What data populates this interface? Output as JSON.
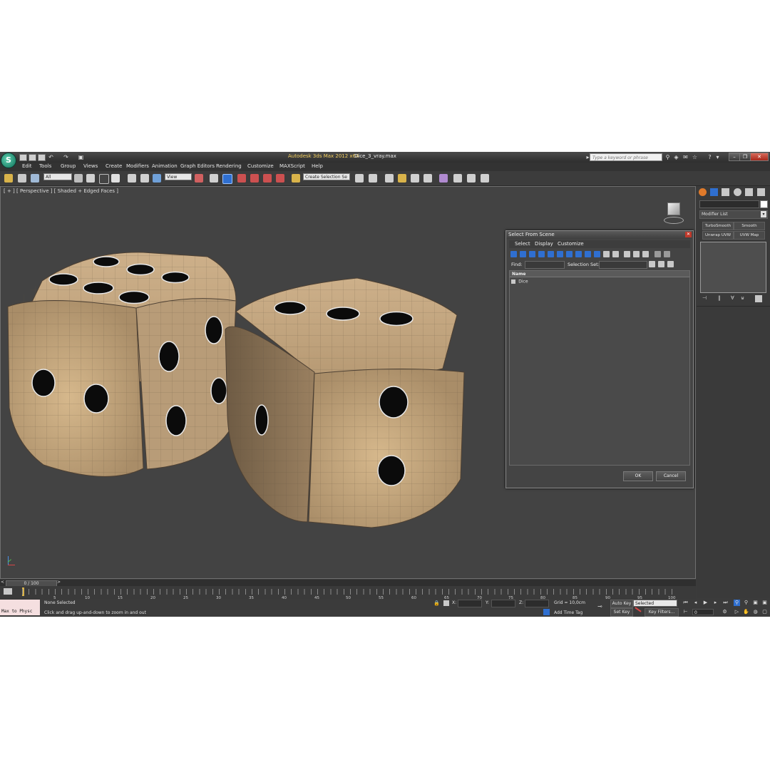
{
  "titlebar": {
    "app_title": "Autodesk 3ds Max  2012 x64",
    "file_name": "Dice_3_vray.max",
    "search_placeholder": "Type a keyword or phrase"
  },
  "menubar": [
    "Edit",
    "Tools",
    "Group",
    "Views",
    "Create",
    "Modifiers",
    "Animation",
    "Graph Editors",
    "Rendering",
    "Customize",
    "MAXScript",
    "Help"
  ],
  "toolbar": {
    "selection_filter": "All",
    "reference_coord": "View",
    "named_selection": "Create Selection Se"
  },
  "viewport": {
    "label": "[ + ] [ Perspective ] [ Shaded + Edged Faces ]"
  },
  "command_panel": {
    "modifier_list": "Modifier List",
    "buttons": [
      "TurboSmooth",
      "Smooth",
      "Unwrap UVW",
      "UVW Map"
    ]
  },
  "dialog": {
    "title": "Select From Scene",
    "menu": [
      "Select",
      "Display",
      "Customize"
    ],
    "find_label": "Find:",
    "selection_set_label": "Selection Set:",
    "column_name": "Name",
    "items": [
      "Dice"
    ],
    "ok": "OK",
    "cancel": "Cancel"
  },
  "timeline": {
    "frame": "0 / 100",
    "ticks": [
      "5",
      "10",
      "15",
      "20",
      "25",
      "30",
      "35",
      "40",
      "45",
      "50",
      "55",
      "60",
      "65",
      "70",
      "75",
      "80",
      "85",
      "90",
      "95",
      "100"
    ]
  },
  "status": {
    "maxscript": "Max to Physc",
    "selection": "None Selected",
    "prompt": "Click and drag up-and-down to zoom in and out",
    "x_label": "X:",
    "y_label": "Y:",
    "z_label": "Z:",
    "grid": "Grid = 10,0cm",
    "add_time_tag": "Add Time Tag",
    "auto_key": "Auto Key",
    "set_key": "Set Key",
    "key_mode": "Selected",
    "key_filters": "Key Filters...",
    "current_frame": "0"
  },
  "colors": {
    "accent_blue": "#2f6fd0",
    "title_accent": "#f4d060",
    "dice_face": "#c8a77a"
  }
}
